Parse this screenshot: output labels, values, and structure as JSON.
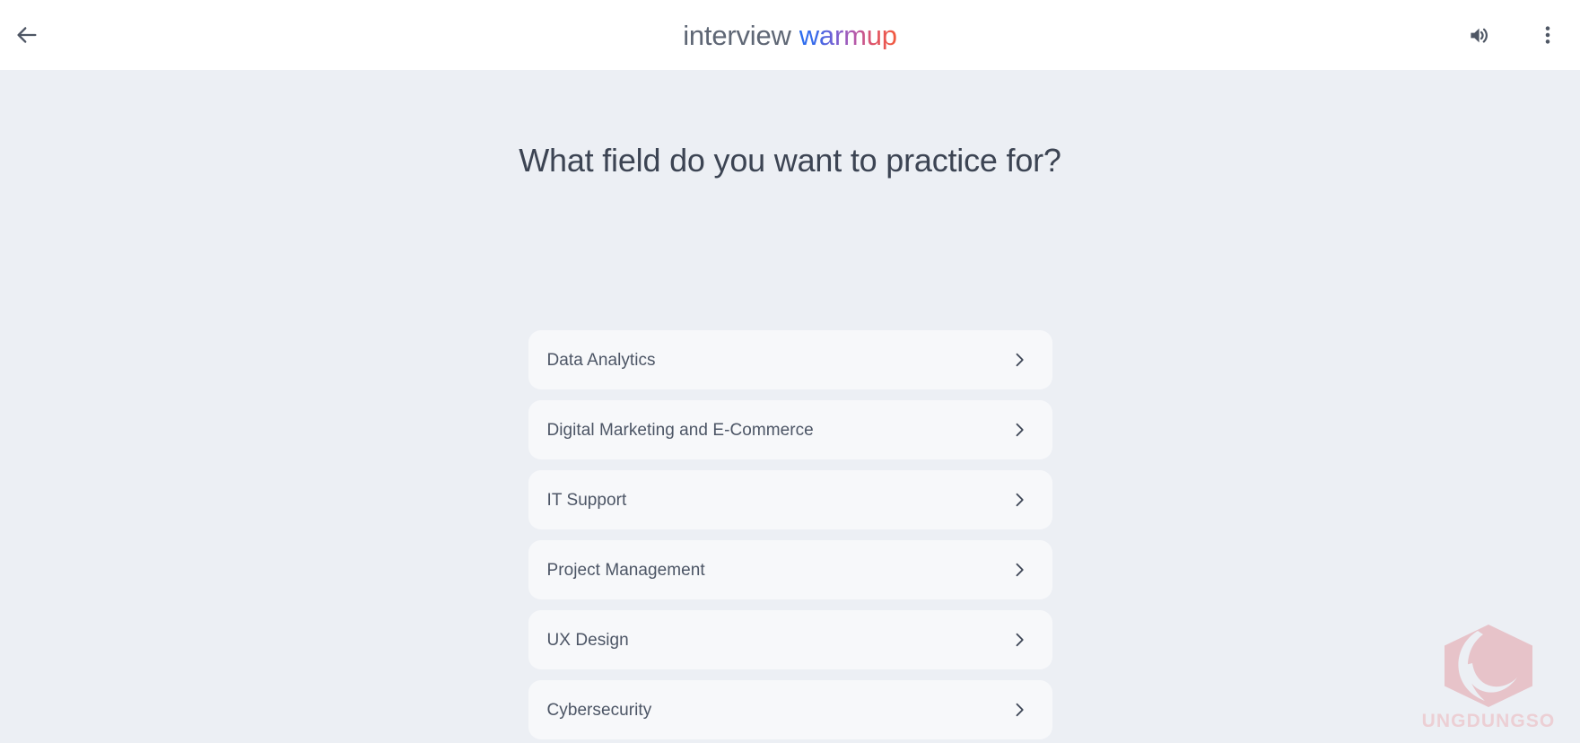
{
  "app": {
    "background_color": "#eceff4",
    "card_color": "#f7f8fa"
  },
  "topbar": {
    "background_color": "#ffffff",
    "back_button": {
      "icon": "arrow-left-icon",
      "label": "Back"
    },
    "brand": {
      "word_one": "interview",
      "word_two": "warmup",
      "word_one_color": "#5f6775",
      "gradient_start": "#2a6ef0",
      "gradient_mid": "#b25ab0",
      "gradient_end": "#f25a3c"
    },
    "sound_button": {
      "icon": "volume-up-icon",
      "label": "Sound"
    },
    "more_button": {
      "icon": "more-vert-icon",
      "label": "More options"
    }
  },
  "main": {
    "title": "What field do you want to practice for?",
    "title_color": "#3c4453",
    "options": [
      {
        "label": "Data Analytics",
        "icon": "chevron-right-icon"
      },
      {
        "label": "Digital Marketing and E-Commerce",
        "icon": "chevron-right-icon"
      },
      {
        "label": "IT Support",
        "icon": "chevron-right-icon"
      },
      {
        "label": "Project Management",
        "icon": "chevron-right-icon"
      },
      {
        "label": "UX Design",
        "icon": "chevron-right-icon"
      },
      {
        "label": "Cybersecurity",
        "icon": "chevron-right-icon"
      }
    ]
  },
  "watermark": {
    "text": "UNGDUNGSO",
    "color": "#eccfd4",
    "mark_icon": "hexagon-crescent-logo"
  }
}
